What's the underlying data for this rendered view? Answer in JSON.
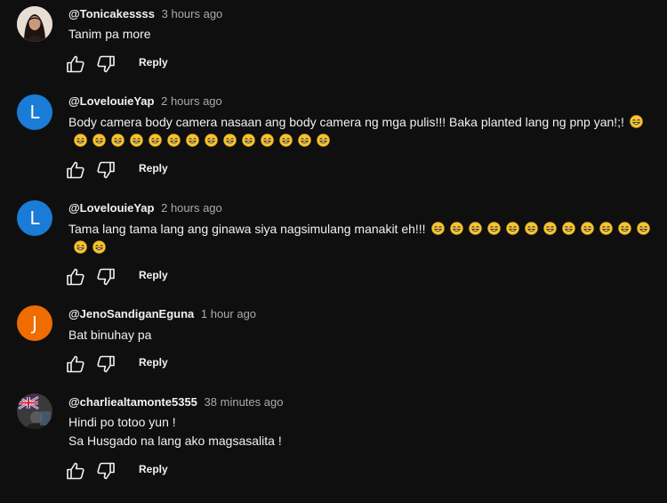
{
  "theme": {
    "background": "#0f0f0f",
    "text": "#f1f1f1",
    "muted": "#aaaaaa",
    "emoji_color": "#f4c430"
  },
  "reply_label": "Reply",
  "comments": [
    {
      "author": "@Tonicakessss",
      "time": "3 hours ago",
      "avatar": {
        "type": "photo",
        "icon": "profile-photo-icon"
      },
      "lines": [
        "Tanim pa more"
      ],
      "emoji_count": 0
    },
    {
      "author": "@LovelouieYap",
      "time": "2 hours ago",
      "avatar": {
        "type": "letter",
        "letter": "L",
        "color": "#1a7cd6"
      },
      "lines": [
        "Body camera body camera nasaan ang body camera ng mga pulis!!! Baka planted lang ng pnp yan!;!"
      ],
      "emoji_count": 15,
      "emoji_icon": "smiling-face-icon"
    },
    {
      "author": "@LovelouieYap",
      "time": "2 hours ago",
      "avatar": {
        "type": "letter",
        "letter": "L",
        "color": "#1a7cd6"
      },
      "lines": [
        "Tama lang tama lang ang ginawa siya nagsimulang manakit eh!!!"
      ],
      "emoji_count": 14,
      "emoji_icon": "smiling-face-icon"
    },
    {
      "author": "@JenoSandiganEguna",
      "time": "1 hour ago",
      "avatar": {
        "type": "letter",
        "letter": "J",
        "color": "#ef6c00"
      },
      "lines": [
        "Bat binuhay pa"
      ],
      "emoji_count": 0
    },
    {
      "author": "@charliealtamonte5355",
      "time": "38 minutes ago",
      "avatar": {
        "type": "photo",
        "icon": "flag-profile-photo-icon"
      },
      "lines": [
        "Hindi po totoo yun !",
        "Sa Husgado na lang ako magsasalita !"
      ],
      "emoji_count": 0
    }
  ]
}
